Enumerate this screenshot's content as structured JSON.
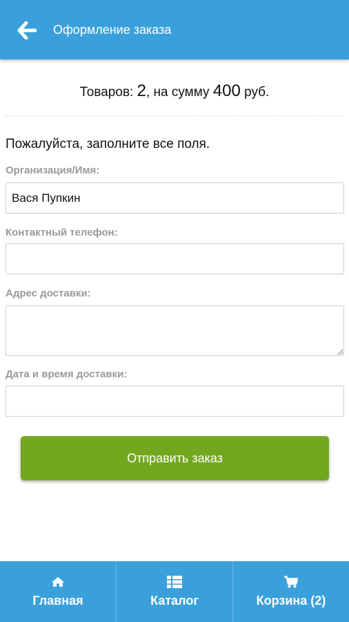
{
  "header": {
    "title": "Оформление заказа",
    "back_icon": "arrow-left-icon"
  },
  "summary": {
    "prefix": "Товаров: ",
    "count": "2",
    "middle": ", на сумму ",
    "amount": "400",
    "suffix": " руб."
  },
  "form": {
    "intro": "Пожалуйста, заполните все поля.",
    "fields": [
      {
        "label": "Организация/Имя:",
        "value": "Вася Пупкин",
        "placeholder": ""
      },
      {
        "label": "Контактный телефон:",
        "value": "",
        "placeholder": ""
      },
      {
        "label": "Адрес доставки:",
        "value": "",
        "placeholder": ""
      },
      {
        "label": "Дата и время доставки:",
        "value": "",
        "placeholder": ""
      }
    ],
    "submit_label": "Отправить заказ"
  },
  "footer": {
    "items": [
      {
        "label": "Главная",
        "icon": "home-icon"
      },
      {
        "label": "Каталог",
        "icon": "list-icon"
      },
      {
        "label": "Корзина (2)",
        "icon": "cart-icon"
      }
    ]
  },
  "colors": {
    "header_bg": "#3aa0dc",
    "submit_bg": "#73a81e",
    "label_color": "#9a9a9a"
  }
}
